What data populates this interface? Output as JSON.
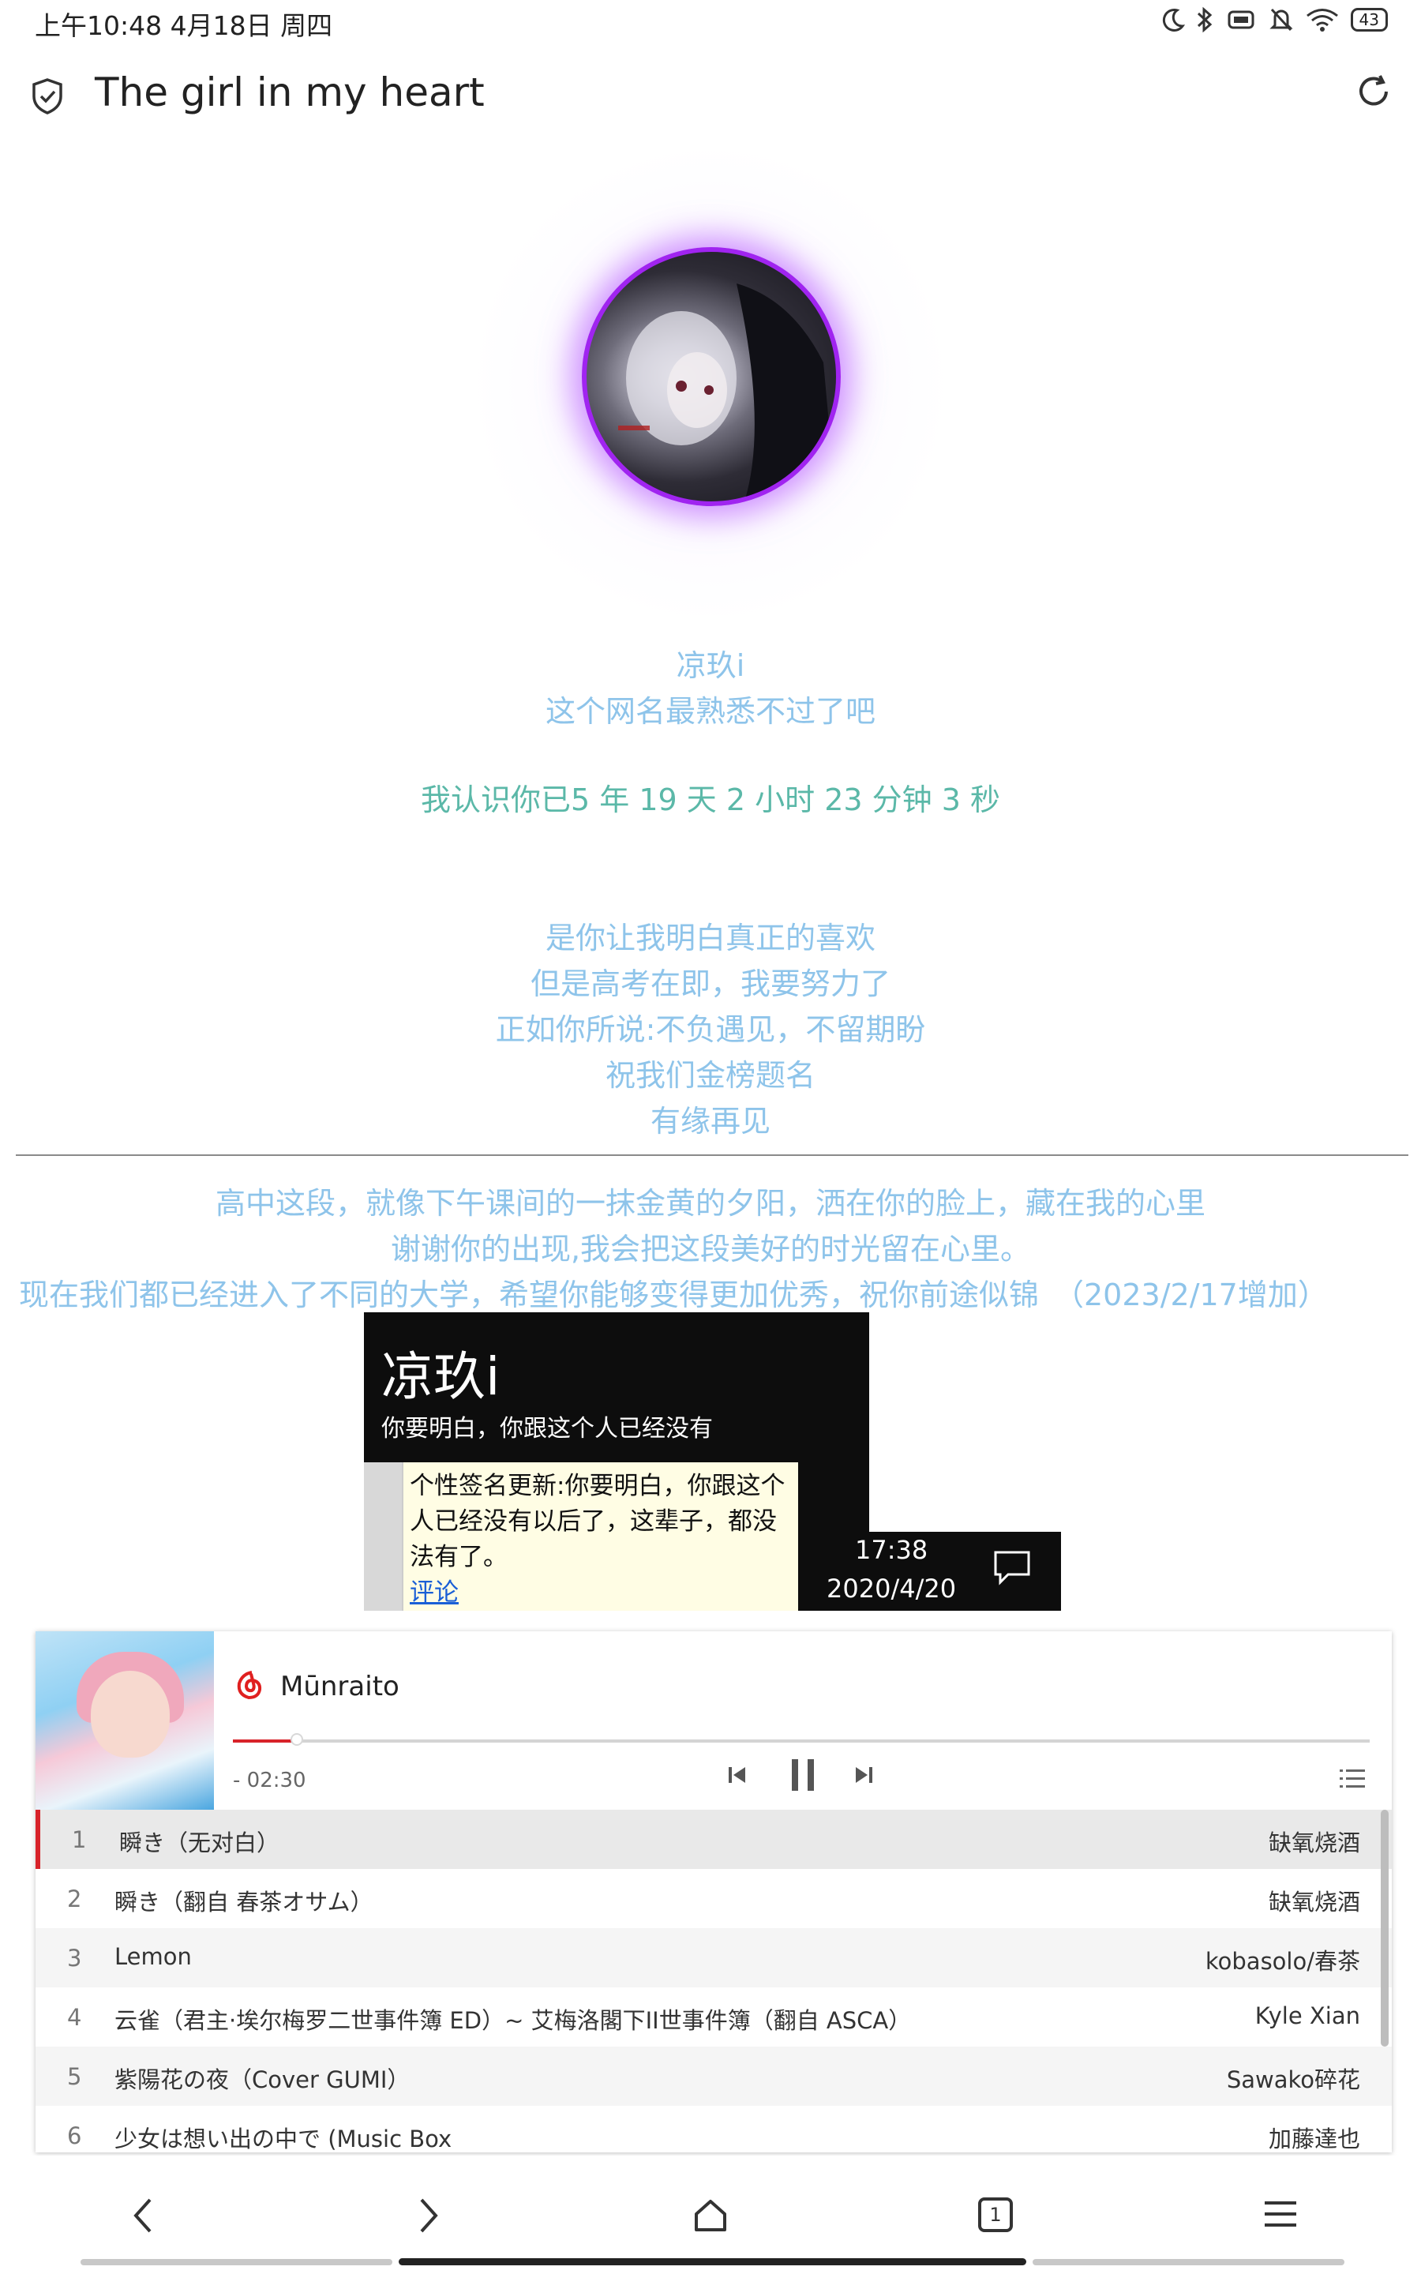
{
  "status_bar": {
    "time": "上午10:48 4月18日 周四",
    "battery": "43",
    "icons": [
      "moon-icon",
      "bluetooth-icon",
      "vibrate-icon",
      "mute-bell-icon",
      "wifi-icon",
      "battery-icon"
    ]
  },
  "header": {
    "title": "The girl in my heart",
    "left_icon": "shield-icon",
    "right_icon": "refresh-icon"
  },
  "intro": {
    "name": "凉玖i",
    "subtitle": "这个网名最熟悉不过了吧",
    "timer": "我认识你已5 年 19 天 2 小时 23 分钟 3 秒"
  },
  "message": [
    "是你让我明白真正的喜欢",
    "但是高考在即，我要努力了",
    "正如你所说:不负遇见，不留期盼",
    "祝我们金榜题名",
    "有缘再见"
  ],
  "addendum": [
    "高中这段，就像下午课间的一抹金黄的夕阳，洒在你的脸上，藏在我的心里",
    "谢谢你的出现,我会把这段美好的时光留在心里。",
    "现在我们都已经进入了不同的大学，希望你能够变得更加优秀，祝你前途似锦　（2023/2/17增加）"
  ],
  "screenshot": {
    "name": "凉玖i",
    "signature": "你要明白，你跟这个人已经没有",
    "popup_text": "个性签名更新:你要明白，你跟这个人已经没有以后了，这辈子，都没法有了。",
    "comment_link": "评论",
    "time": "17:38",
    "date": "2020/4/20"
  },
  "player": {
    "song_title": "Mūnraito",
    "time_remaining": "- 02:30",
    "progress": 0.055,
    "accent_color": "#d8232a",
    "playlist": [
      {
        "num": "1",
        "song": "瞬き（无对白）",
        "artist": "缺氧烧酒"
      },
      {
        "num": "2",
        "song": "瞬き（翻自 春茶オサム）",
        "artist": "缺氧烧酒"
      },
      {
        "num": "3",
        "song": "Lemon",
        "artist": "kobasolo/春茶"
      },
      {
        "num": "4",
        "song": "云雀（君主·埃尔梅罗二世事件簿 ED）~ 艾梅洛閣下II世事件簿（翻自 ASCA）",
        "artist": "Kyle Xian"
      },
      {
        "num": "5",
        "song": "紫陽花の夜（Cover GUMI）",
        "artist": "Sawako碎花"
      },
      {
        "num": "6",
        "song": "少女は想い出の中で (Music Box",
        "artist": "加藤達也"
      }
    ]
  },
  "bottom_nav": {
    "tab_count": "1",
    "icons": [
      "back-icon",
      "forward-icon",
      "home-icon",
      "tabs-icon",
      "menu-icon"
    ]
  }
}
